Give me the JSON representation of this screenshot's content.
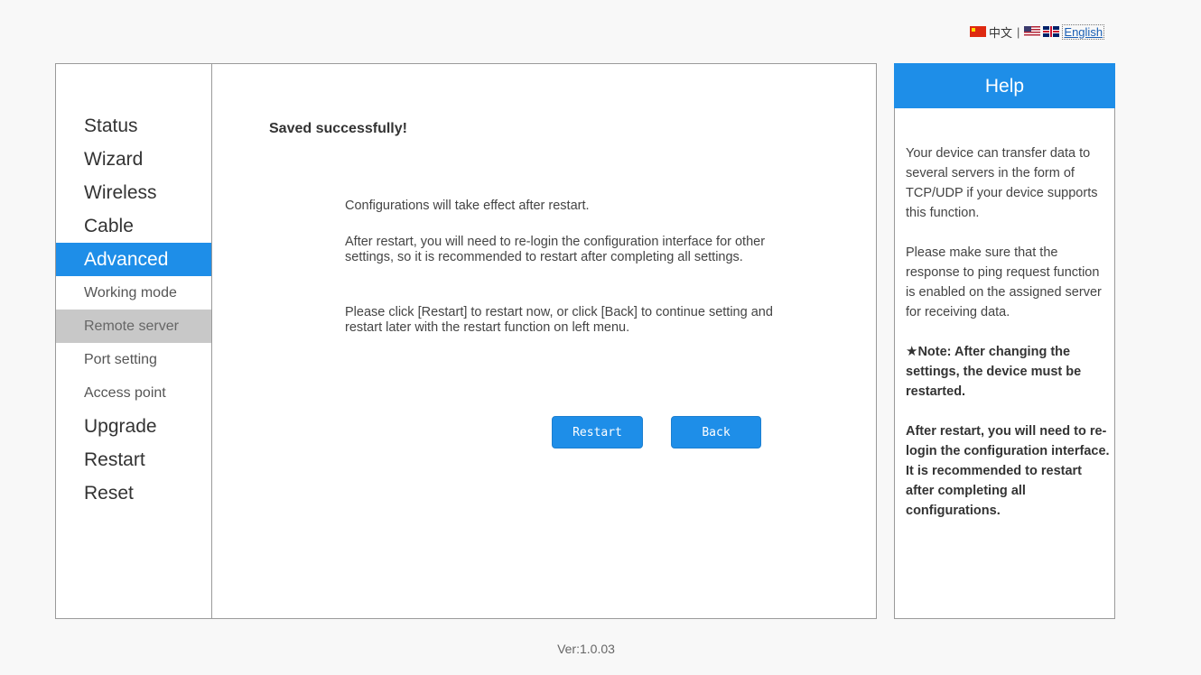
{
  "language_bar": {
    "chinese_label": "中文",
    "separator": "|",
    "english_label": "English",
    "cn_flag_icon": "china-flag-icon",
    "us_flag_icon": "us-flag-icon",
    "uk_flag_icon": "uk-flag-icon"
  },
  "sidebar": {
    "items": [
      {
        "label": "Status"
      },
      {
        "label": "Wizard"
      },
      {
        "label": "Wireless"
      },
      {
        "label": "Cable"
      },
      {
        "label": "Advanced"
      },
      {
        "label": "Working mode"
      },
      {
        "label": "Remote server"
      },
      {
        "label": "Port setting"
      },
      {
        "label": "Access point"
      },
      {
        "label": "Upgrade"
      },
      {
        "label": "Restart"
      },
      {
        "label": "Reset"
      }
    ],
    "active_item": "Advanced",
    "selected_subitem": "Remote server"
  },
  "content": {
    "title": "Saved successfully!",
    "message1": "Configurations will take effect after restart.",
    "message2": "After restart, you will need to re-login the configuration interface for other settings, so it is recommended to restart after completing all settings.",
    "message3": "Please click [Restart] to restart now, or click [Back] to continue setting and restart later with the restart function on left menu.",
    "restart_button": "Restart",
    "back_button": "Back"
  },
  "help": {
    "title": "Help",
    "para1": "Your device can transfer data to several servers in the form of TCP/UDP if your device supports this function.",
    "para2": "Please make sure that the response to ping request function is enabled on the assigned server for receiving data.",
    "note_icon": "★",
    "para3": "Note: After changing the settings, the device must be restarted.",
    "para4": "After restart, you will need to re-login the configuration interface. It is recommended to restart after completing all configurations."
  },
  "footer": {
    "version": "Ver:1.0.03"
  },
  "colors": {
    "accent": "#1e8ee8",
    "selected_subitem_bg": "#c8c8c8",
    "background": "#f8f8f8"
  }
}
